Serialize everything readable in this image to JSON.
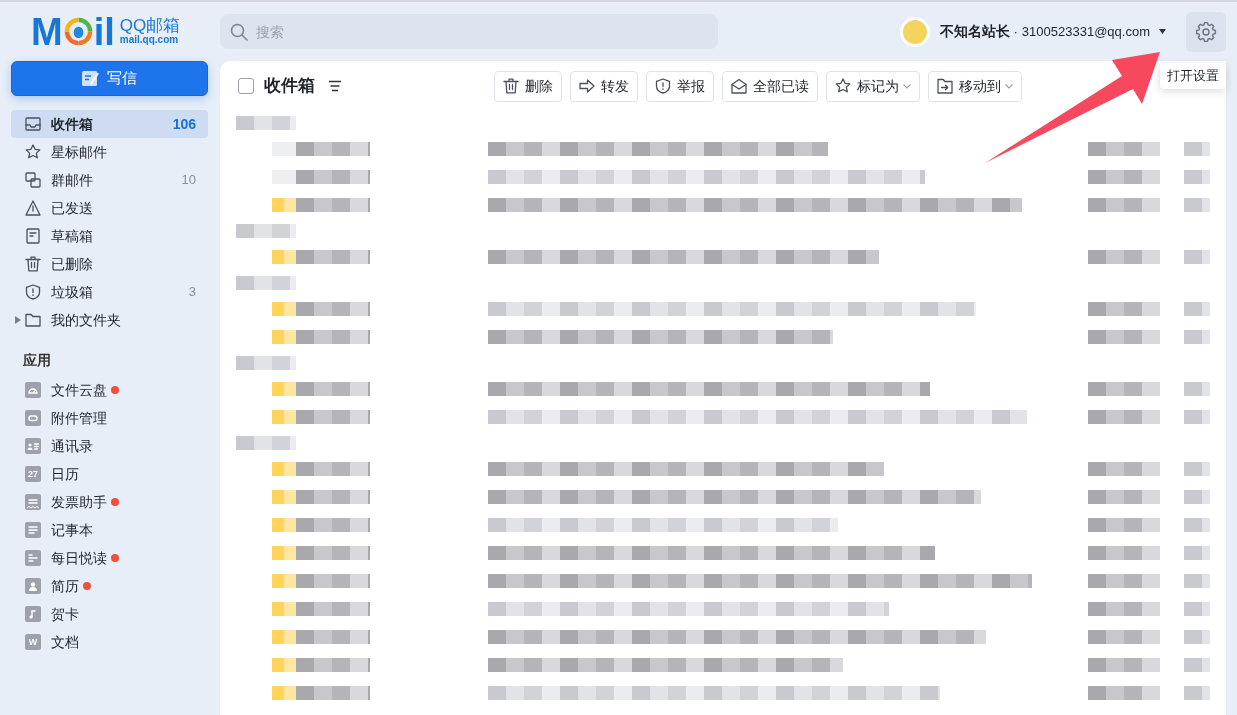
{
  "logo": {
    "prefix": "M",
    "suffix": "il",
    "product": "QQ邮箱",
    "domain": "mail.qq.com"
  },
  "search": {
    "placeholder": "搜索"
  },
  "account": {
    "nickname": "不知名站长",
    "separator": "·",
    "email": "3100523331@qq.com"
  },
  "settings_tooltip": "打开设置",
  "sidebar": {
    "compose": "写信",
    "folders": [
      {
        "label": "收件箱",
        "count": "106",
        "selected": true
      },
      {
        "label": "星标邮件",
        "selected": false
      },
      {
        "label": "群邮件",
        "count": "10",
        "selected": false
      },
      {
        "label": "已发送",
        "selected": false
      },
      {
        "label": "草稿箱",
        "selected": false
      },
      {
        "label": "已删除",
        "selected": false
      },
      {
        "label": "垃圾箱",
        "count": "3",
        "selected": false
      },
      {
        "label": "我的文件夹",
        "selected": false,
        "expanded": false
      }
    ],
    "apps_title": "应用",
    "apps": [
      {
        "label": "文件云盘",
        "new": true
      },
      {
        "label": "附件管理",
        "new": false
      },
      {
        "label": "通讯录",
        "new": false
      },
      {
        "label": "日历",
        "new": false,
        "icon_text": "27"
      },
      {
        "label": "发票助手",
        "new": true
      },
      {
        "label": "记事本",
        "new": false
      },
      {
        "label": "每日悦读",
        "new": true
      },
      {
        "label": "简历",
        "new": true
      },
      {
        "label": "贺卡",
        "new": false
      },
      {
        "label": "文档",
        "new": false,
        "icon_text": "W"
      }
    ]
  },
  "toolbar": {
    "select_all": {
      "checked": false
    },
    "title": "收件箱",
    "actions": [
      {
        "label": "删除",
        "dropdown": false
      },
      {
        "label": "转发",
        "dropdown": false
      },
      {
        "label": "举报",
        "dropdown": false
      },
      {
        "label": "全部已读",
        "dropdown": false
      },
      {
        "label": "标记为",
        "dropdown": true
      },
      {
        "label": "移动到",
        "dropdown": true
      }
    ]
  },
  "mail_list": {
    "rows": [
      {
        "kind": "group"
      },
      {
        "kind": "message",
        "marked": false
      },
      {
        "kind": "message",
        "marked": false
      },
      {
        "kind": "message",
        "marked": true
      },
      {
        "kind": "group"
      },
      {
        "kind": "message",
        "marked": true
      },
      {
        "kind": "group"
      },
      {
        "kind": "message",
        "marked": true
      },
      {
        "kind": "message",
        "marked": true
      },
      {
        "kind": "group"
      },
      {
        "kind": "message",
        "marked": true
      },
      {
        "kind": "message",
        "marked": true
      },
      {
        "kind": "group"
      },
      {
        "kind": "message",
        "marked": true
      },
      {
        "kind": "message",
        "marked": true
      },
      {
        "kind": "message",
        "marked": true
      },
      {
        "kind": "message",
        "marked": true
      },
      {
        "kind": "message",
        "marked": true
      },
      {
        "kind": "message",
        "marked": true
      },
      {
        "kind": "message",
        "marked": true
      },
      {
        "kind": "message",
        "marked": true
      },
      {
        "kind": "message",
        "marked": true
      }
    ]
  }
}
